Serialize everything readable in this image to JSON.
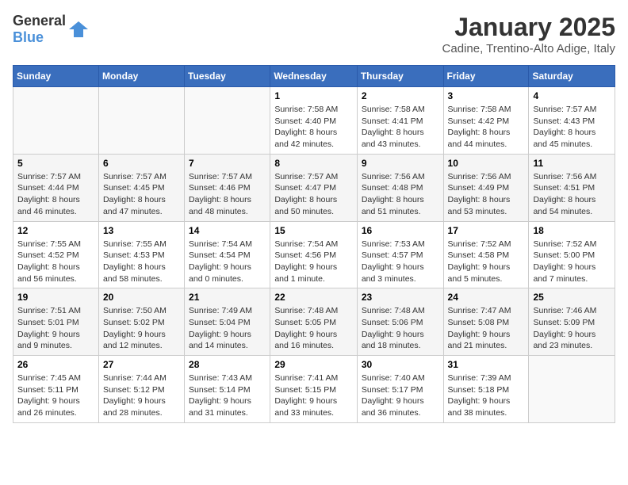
{
  "logo": {
    "general": "General",
    "blue": "Blue"
  },
  "title": "January 2025",
  "location": "Cadine, Trentino-Alto Adige, Italy",
  "headers": [
    "Sunday",
    "Monday",
    "Tuesday",
    "Wednesday",
    "Thursday",
    "Friday",
    "Saturday"
  ],
  "weeks": [
    [
      {
        "day": "",
        "info": ""
      },
      {
        "day": "",
        "info": ""
      },
      {
        "day": "",
        "info": ""
      },
      {
        "day": "1",
        "info": "Sunrise: 7:58 AM\nSunset: 4:40 PM\nDaylight: 8 hours and 42 minutes."
      },
      {
        "day": "2",
        "info": "Sunrise: 7:58 AM\nSunset: 4:41 PM\nDaylight: 8 hours and 43 minutes."
      },
      {
        "day": "3",
        "info": "Sunrise: 7:58 AM\nSunset: 4:42 PM\nDaylight: 8 hours and 44 minutes."
      },
      {
        "day": "4",
        "info": "Sunrise: 7:57 AM\nSunset: 4:43 PM\nDaylight: 8 hours and 45 minutes."
      }
    ],
    [
      {
        "day": "5",
        "info": "Sunrise: 7:57 AM\nSunset: 4:44 PM\nDaylight: 8 hours and 46 minutes."
      },
      {
        "day": "6",
        "info": "Sunrise: 7:57 AM\nSunset: 4:45 PM\nDaylight: 8 hours and 47 minutes."
      },
      {
        "day": "7",
        "info": "Sunrise: 7:57 AM\nSunset: 4:46 PM\nDaylight: 8 hours and 48 minutes."
      },
      {
        "day": "8",
        "info": "Sunrise: 7:57 AM\nSunset: 4:47 PM\nDaylight: 8 hours and 50 minutes."
      },
      {
        "day": "9",
        "info": "Sunrise: 7:56 AM\nSunset: 4:48 PM\nDaylight: 8 hours and 51 minutes."
      },
      {
        "day": "10",
        "info": "Sunrise: 7:56 AM\nSunset: 4:49 PM\nDaylight: 8 hours and 53 minutes."
      },
      {
        "day": "11",
        "info": "Sunrise: 7:56 AM\nSunset: 4:51 PM\nDaylight: 8 hours and 54 minutes."
      }
    ],
    [
      {
        "day": "12",
        "info": "Sunrise: 7:55 AM\nSunset: 4:52 PM\nDaylight: 8 hours and 56 minutes."
      },
      {
        "day": "13",
        "info": "Sunrise: 7:55 AM\nSunset: 4:53 PM\nDaylight: 8 hours and 58 minutes."
      },
      {
        "day": "14",
        "info": "Sunrise: 7:54 AM\nSunset: 4:54 PM\nDaylight: 9 hours and 0 minutes."
      },
      {
        "day": "15",
        "info": "Sunrise: 7:54 AM\nSunset: 4:56 PM\nDaylight: 9 hours and 1 minute."
      },
      {
        "day": "16",
        "info": "Sunrise: 7:53 AM\nSunset: 4:57 PM\nDaylight: 9 hours and 3 minutes."
      },
      {
        "day": "17",
        "info": "Sunrise: 7:52 AM\nSunset: 4:58 PM\nDaylight: 9 hours and 5 minutes."
      },
      {
        "day": "18",
        "info": "Sunrise: 7:52 AM\nSunset: 5:00 PM\nDaylight: 9 hours and 7 minutes."
      }
    ],
    [
      {
        "day": "19",
        "info": "Sunrise: 7:51 AM\nSunset: 5:01 PM\nDaylight: 9 hours and 9 minutes."
      },
      {
        "day": "20",
        "info": "Sunrise: 7:50 AM\nSunset: 5:02 PM\nDaylight: 9 hours and 12 minutes."
      },
      {
        "day": "21",
        "info": "Sunrise: 7:49 AM\nSunset: 5:04 PM\nDaylight: 9 hours and 14 minutes."
      },
      {
        "day": "22",
        "info": "Sunrise: 7:48 AM\nSunset: 5:05 PM\nDaylight: 9 hours and 16 minutes."
      },
      {
        "day": "23",
        "info": "Sunrise: 7:48 AM\nSunset: 5:06 PM\nDaylight: 9 hours and 18 minutes."
      },
      {
        "day": "24",
        "info": "Sunrise: 7:47 AM\nSunset: 5:08 PM\nDaylight: 9 hours and 21 minutes."
      },
      {
        "day": "25",
        "info": "Sunrise: 7:46 AM\nSunset: 5:09 PM\nDaylight: 9 hours and 23 minutes."
      }
    ],
    [
      {
        "day": "26",
        "info": "Sunrise: 7:45 AM\nSunset: 5:11 PM\nDaylight: 9 hours and 26 minutes."
      },
      {
        "day": "27",
        "info": "Sunrise: 7:44 AM\nSunset: 5:12 PM\nDaylight: 9 hours and 28 minutes."
      },
      {
        "day": "28",
        "info": "Sunrise: 7:43 AM\nSunset: 5:14 PM\nDaylight: 9 hours and 31 minutes."
      },
      {
        "day": "29",
        "info": "Sunrise: 7:41 AM\nSunset: 5:15 PM\nDaylight: 9 hours and 33 minutes."
      },
      {
        "day": "30",
        "info": "Sunrise: 7:40 AM\nSunset: 5:17 PM\nDaylight: 9 hours and 36 minutes."
      },
      {
        "day": "31",
        "info": "Sunrise: 7:39 AM\nSunset: 5:18 PM\nDaylight: 9 hours and 38 minutes."
      },
      {
        "day": "",
        "info": ""
      }
    ]
  ]
}
